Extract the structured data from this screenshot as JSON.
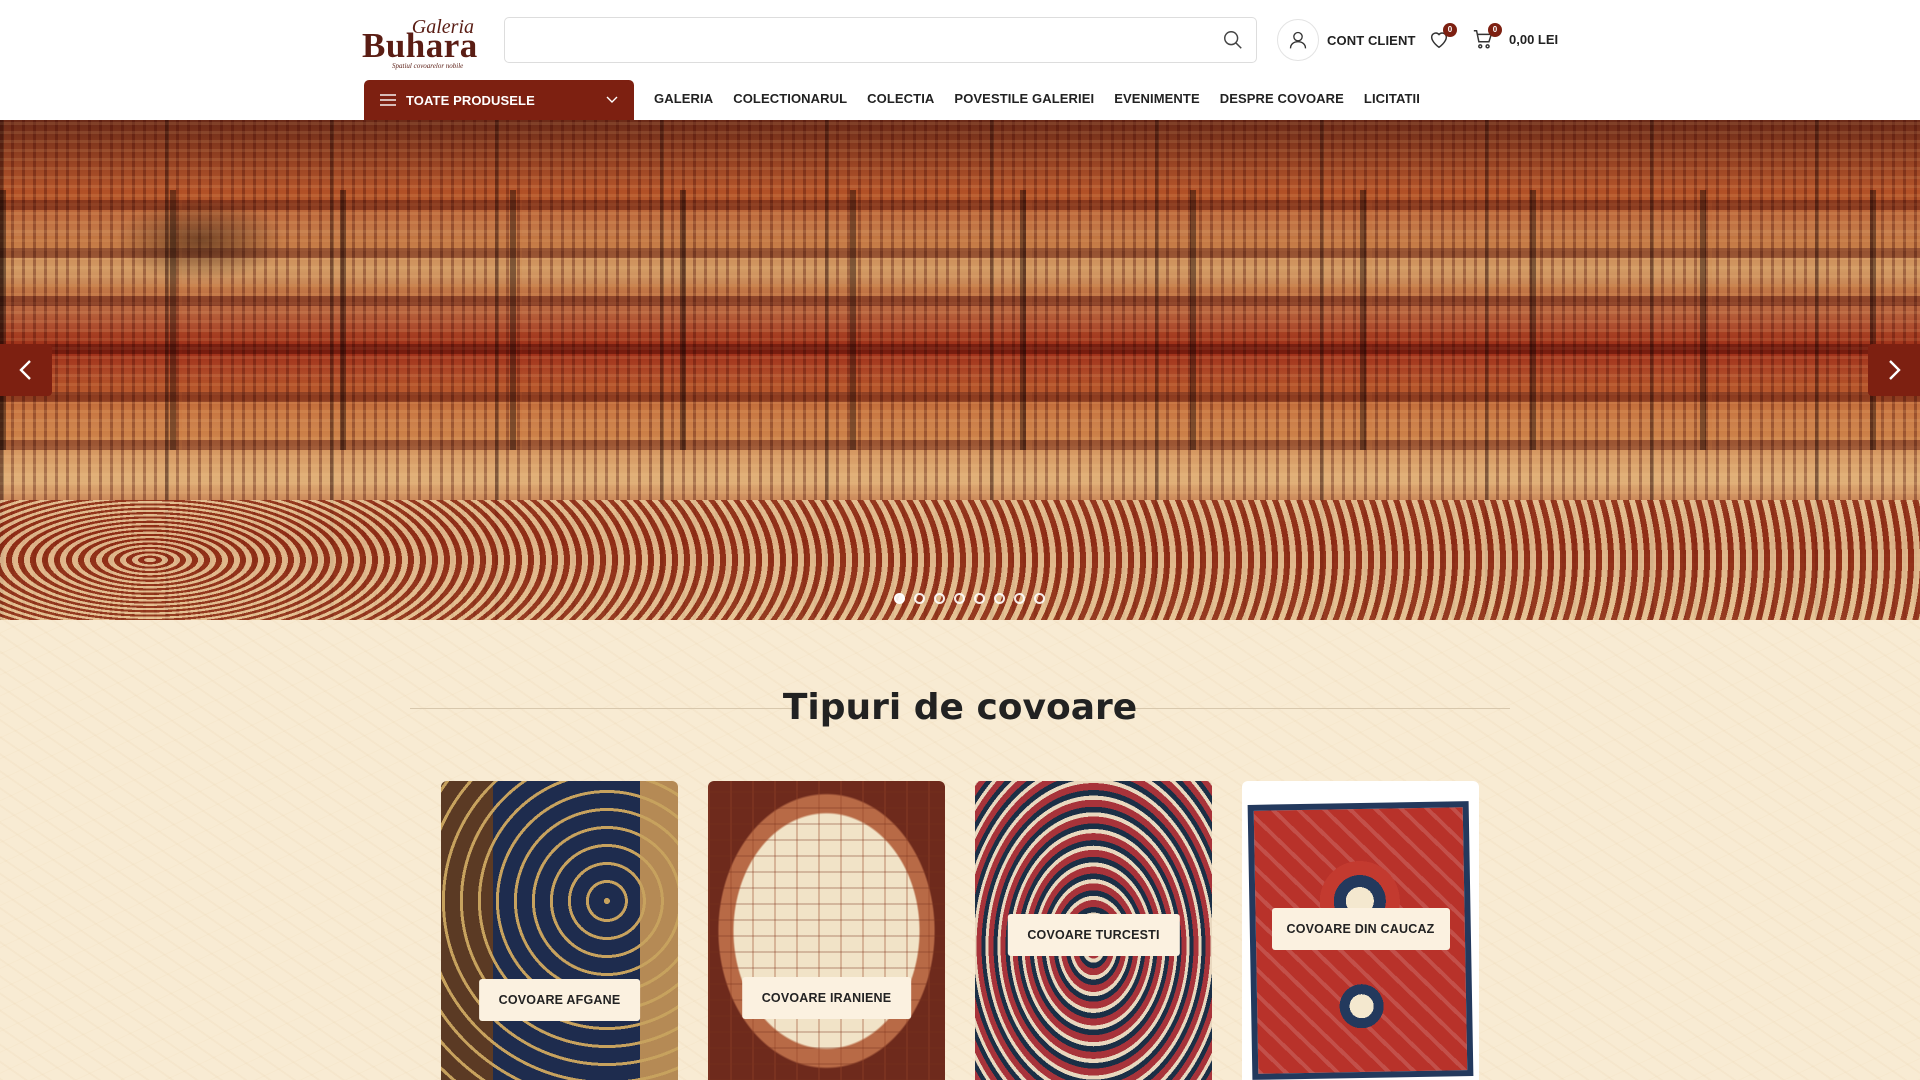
{
  "brand": {
    "top": "Galeria",
    "name": "Buhara",
    "tagline": "Spatiul covoarelor nobile",
    "accent_color": "#7d2011"
  },
  "search": {
    "placeholder": "",
    "value": "",
    "icon": "search-icon"
  },
  "account": {
    "label": "CONT CLIENT",
    "icon": "user-icon"
  },
  "wishlist": {
    "count": "0",
    "icon": "heart-icon"
  },
  "cart": {
    "count": "0",
    "total": "0,00 LEI",
    "icon": "cart-icon"
  },
  "categories_menu": {
    "label": "TOATE PRODUSELE",
    "icon": "menu-icon"
  },
  "nav": {
    "items": [
      {
        "label": "GALERIA"
      },
      {
        "label": "COLECTIONARUL"
      },
      {
        "label": "COLECTIA"
      },
      {
        "label": "POVESTILE GALERIEI"
      },
      {
        "label": "EVENIMENTE"
      },
      {
        "label": "DESPRE COVOARE"
      },
      {
        "label": "LICITATII"
      }
    ]
  },
  "hero": {
    "slide_count": 8,
    "active_slide": 0
  },
  "section": {
    "title": "Tipuri de covoare",
    "cards": [
      {
        "label": "COVOARE AFGANE"
      },
      {
        "label": "COVOARE IRANIENE"
      },
      {
        "label": "COVOARE TURCESTI"
      },
      {
        "label": "COVOARE DIN CAUCAZ"
      }
    ]
  }
}
